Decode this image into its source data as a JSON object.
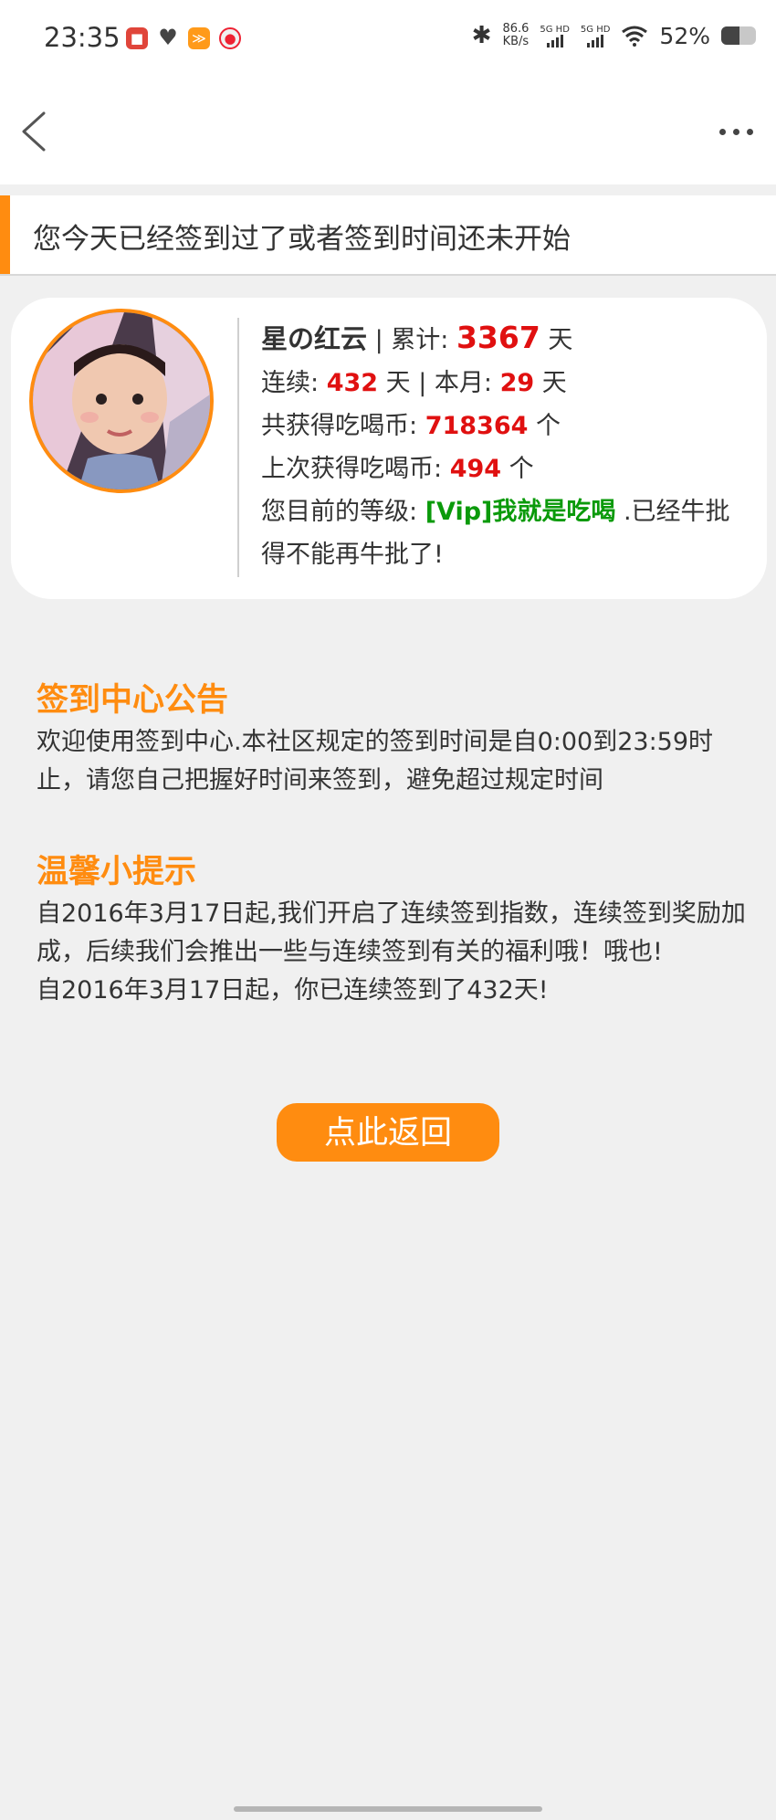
{
  "status_bar": {
    "time": "23:35",
    "net_speed_value": "86.6",
    "net_speed_unit": "KB/s",
    "sim1_label": "5G HD",
    "sim2_label": "5G HD",
    "battery_percent": "52%",
    "battery_level": 0.52,
    "icons": [
      "notification-app-icon",
      "heart-icon",
      "app-icon",
      "app-icon",
      "bluetooth-icon",
      "signal-icon",
      "signal-icon",
      "wifi-icon",
      "battery-icon"
    ]
  },
  "nav": {
    "back_icon": "chevron-left-icon",
    "more_icon": "more-dots-icon"
  },
  "message": {
    "text": "您今天已经签到过了或者签到时间还未开始"
  },
  "profile": {
    "username": "星の红云",
    "total_label": " | 累计: ",
    "total_days": "3367",
    "day_unit": " 天",
    "streak_label": "连续: ",
    "streak_days": "432",
    "month_label": " 天 | 本月: ",
    "month_days": "29",
    "coins_label": "共获得吃喝币: ",
    "coins_total": "718364",
    "coins_unit": " 个",
    "last_label": "上次获得吃喝币: ",
    "last_coins": "494",
    "level_label": "您目前的等级: ",
    "level_name": "[Vip]我就是吃喝",
    "level_desc": " .已经牛批得不能再牛批了!"
  },
  "announcement": {
    "title": "签到中心公告",
    "body": "欢迎使用签到中心.本社区规定的签到时间是自0:00到23:59时止，请您自己把握好时间来签到，避免超过规定时间"
  },
  "tips": {
    "title": "温馨小提示",
    "body_line1": "自2016年3月17日起,我们开启了连续签到指数，连续签到奖励加成，后续我们会推出一些与连续签到有关的福利哦！哦也!",
    "body_line2": "自2016年3月17日起，你已连续签到了432天!"
  },
  "return_button": {
    "label": "点此返回"
  },
  "colors": {
    "accent": "#ff8c10",
    "highlight_red": "#e01010",
    "level_green": "#0a9a0a",
    "background": "#f0f0f0"
  }
}
